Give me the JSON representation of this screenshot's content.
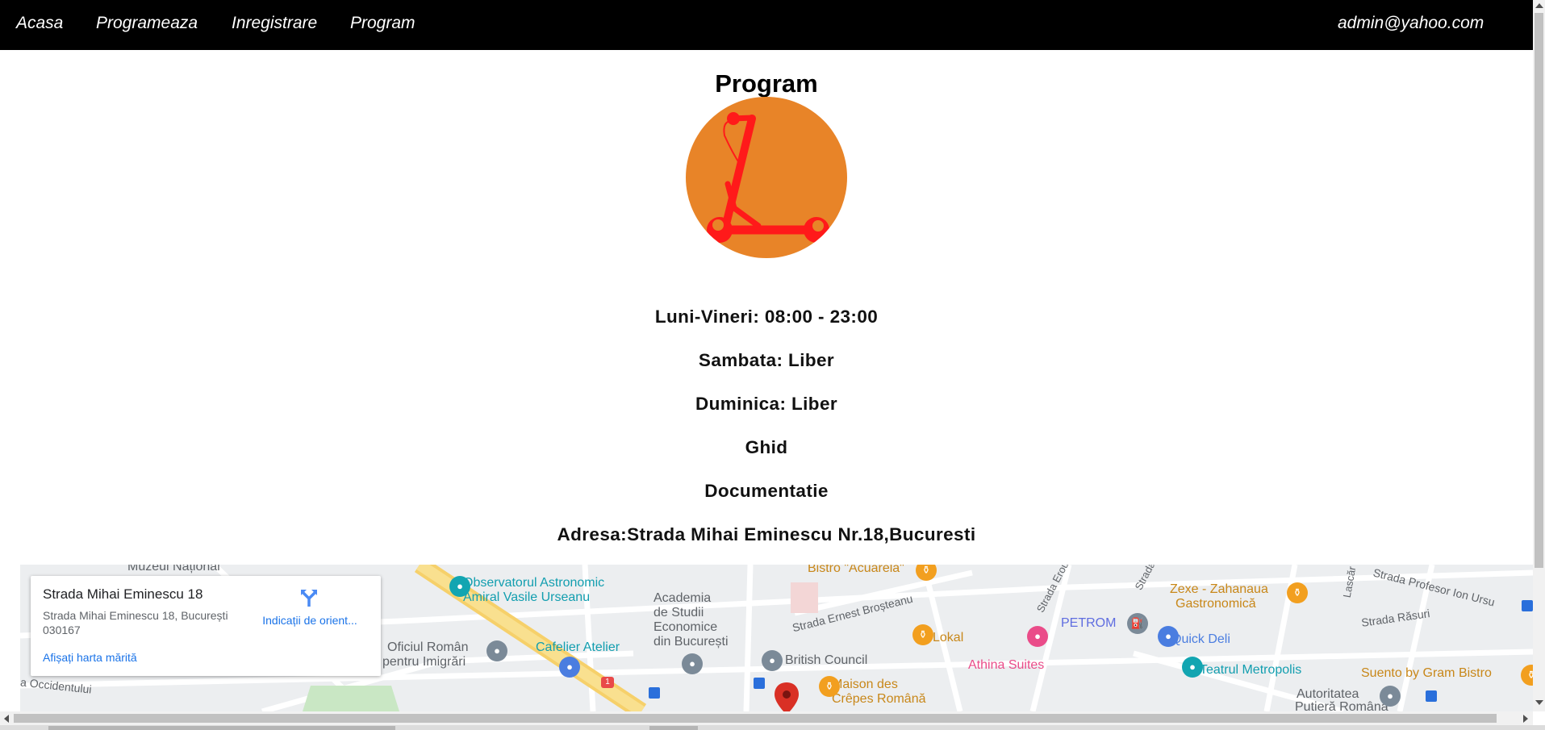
{
  "nav": {
    "links": [
      "Acasa",
      "Programeaza",
      "Inregistrare",
      "Program"
    ],
    "user_email": "admin@yahoo.com"
  },
  "page": {
    "title": "Program",
    "hours_weekdays": "Luni-Vineri: 08:00 - 23:00",
    "hours_saturday": "Sambata: Liber",
    "hours_sunday": "Duminica: Liber",
    "guide_link": "Ghid",
    "docs_link": "Documentatie",
    "address": "Adresa:Strada Mihai Eminescu Nr.18,Bucuresti"
  },
  "map": {
    "card": {
      "place_name": "Strada Mihai Eminescu 18",
      "address_line1": "Strada Mihai Eminescu 18, București",
      "address_line2": "030167",
      "directions_label": "Indicații de orient...",
      "larger_map_link": "Afișați harta mărită"
    },
    "labels": {
      "muzeu": "Muzeul Național",
      "observator1": "Observatorul Astronomic",
      "observator2": "Amiral Vasile Urseanu",
      "bistro": "Bistro \"Acuarela\"",
      "strada_erou": "Strada Erou",
      "strada_str": "Strada",
      "zexe1": "Zexe - Zahanaua",
      "zexe2": "Gastronomică",
      "lascar": "Lascăr",
      "strada_profesor": "Strada Profesor Ion Ursu",
      "academia1": "Academia",
      "academia2": "de Studii",
      "academia3": "Economice",
      "academia4": "din București",
      "strada_brosteanu": "Strada Ernest Broșteanu",
      "petrom": "PETROM",
      "strada_rasuri": "Strada Răsuri",
      "oficiul1": "Oficiul Român",
      "oficiul2": "pentru Imigrări",
      "cafelier": "Cafelier Atelier",
      "lokal": "Lokal",
      "quick_deli": "Quick Deli",
      "british_council": "British Council",
      "athina": "Athina Suites",
      "teatrul": "Teatrul Metropolis",
      "occidentului": "a Occidentului",
      "maison1": "Maison des",
      "maison2": "Crêpes Română",
      "suento": "Suento by Gram Bistro",
      "autoritatea": "Autoritatea",
      "putiera": "Putieră Română",
      "road_number": "1"
    }
  },
  "colors": {
    "navbar_bg": "#000000",
    "logo_bg": "#e88428",
    "scooter": "#ff1a1a",
    "map_link": "#1a73e8",
    "poi_orange": "#f29f1f",
    "poi_teal": "#12a5b1",
    "poi_pink": "#ea4c89",
    "poi_gray": "#7b8a98",
    "pin_red": "#d93025"
  }
}
